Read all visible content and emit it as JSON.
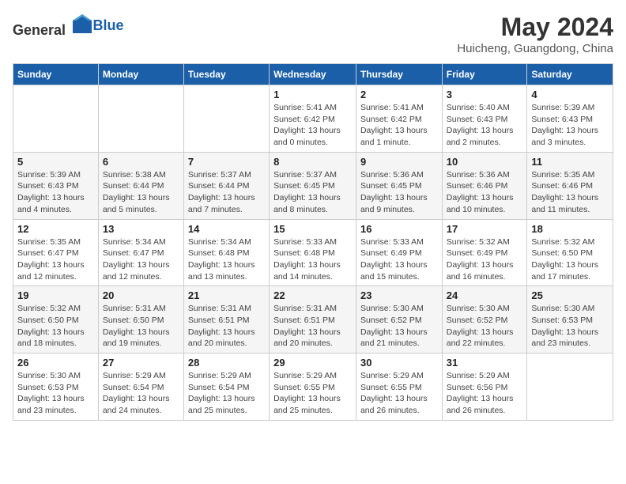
{
  "header": {
    "logo_general": "General",
    "logo_blue": "Blue",
    "month_title": "May 2024",
    "location": "Huicheng, Guangdong, China"
  },
  "weekdays": [
    "Sunday",
    "Monday",
    "Tuesday",
    "Wednesday",
    "Thursday",
    "Friday",
    "Saturday"
  ],
  "weeks": [
    [
      {
        "day": "",
        "sunrise": "",
        "sunset": "",
        "daylight": ""
      },
      {
        "day": "",
        "sunrise": "",
        "sunset": "",
        "daylight": ""
      },
      {
        "day": "",
        "sunrise": "",
        "sunset": "",
        "daylight": ""
      },
      {
        "day": "1",
        "sunrise": "Sunrise: 5:41 AM",
        "sunset": "Sunset: 6:42 PM",
        "daylight": "Daylight: 13 hours and 0 minutes."
      },
      {
        "day": "2",
        "sunrise": "Sunrise: 5:41 AM",
        "sunset": "Sunset: 6:42 PM",
        "daylight": "Daylight: 13 hours and 1 minute."
      },
      {
        "day": "3",
        "sunrise": "Sunrise: 5:40 AM",
        "sunset": "Sunset: 6:43 PM",
        "daylight": "Daylight: 13 hours and 2 minutes."
      },
      {
        "day": "4",
        "sunrise": "Sunrise: 5:39 AM",
        "sunset": "Sunset: 6:43 PM",
        "daylight": "Daylight: 13 hours and 3 minutes."
      }
    ],
    [
      {
        "day": "5",
        "sunrise": "Sunrise: 5:39 AM",
        "sunset": "Sunset: 6:43 PM",
        "daylight": "Daylight: 13 hours and 4 minutes."
      },
      {
        "day": "6",
        "sunrise": "Sunrise: 5:38 AM",
        "sunset": "Sunset: 6:44 PM",
        "daylight": "Daylight: 13 hours and 5 minutes."
      },
      {
        "day": "7",
        "sunrise": "Sunrise: 5:37 AM",
        "sunset": "Sunset: 6:44 PM",
        "daylight": "Daylight: 13 hours and 7 minutes."
      },
      {
        "day": "8",
        "sunrise": "Sunrise: 5:37 AM",
        "sunset": "Sunset: 6:45 PM",
        "daylight": "Daylight: 13 hours and 8 minutes."
      },
      {
        "day": "9",
        "sunrise": "Sunrise: 5:36 AM",
        "sunset": "Sunset: 6:45 PM",
        "daylight": "Daylight: 13 hours and 9 minutes."
      },
      {
        "day": "10",
        "sunrise": "Sunrise: 5:36 AM",
        "sunset": "Sunset: 6:46 PM",
        "daylight": "Daylight: 13 hours and 10 minutes."
      },
      {
        "day": "11",
        "sunrise": "Sunrise: 5:35 AM",
        "sunset": "Sunset: 6:46 PM",
        "daylight": "Daylight: 13 hours and 11 minutes."
      }
    ],
    [
      {
        "day": "12",
        "sunrise": "Sunrise: 5:35 AM",
        "sunset": "Sunset: 6:47 PM",
        "daylight": "Daylight: 13 hours and 12 minutes."
      },
      {
        "day": "13",
        "sunrise": "Sunrise: 5:34 AM",
        "sunset": "Sunset: 6:47 PM",
        "daylight": "Daylight: 13 hours and 12 minutes."
      },
      {
        "day": "14",
        "sunrise": "Sunrise: 5:34 AM",
        "sunset": "Sunset: 6:48 PM",
        "daylight": "Daylight: 13 hours and 13 minutes."
      },
      {
        "day": "15",
        "sunrise": "Sunrise: 5:33 AM",
        "sunset": "Sunset: 6:48 PM",
        "daylight": "Daylight: 13 hours and 14 minutes."
      },
      {
        "day": "16",
        "sunrise": "Sunrise: 5:33 AM",
        "sunset": "Sunset: 6:49 PM",
        "daylight": "Daylight: 13 hours and 15 minutes."
      },
      {
        "day": "17",
        "sunrise": "Sunrise: 5:32 AM",
        "sunset": "Sunset: 6:49 PM",
        "daylight": "Daylight: 13 hours and 16 minutes."
      },
      {
        "day": "18",
        "sunrise": "Sunrise: 5:32 AM",
        "sunset": "Sunset: 6:50 PM",
        "daylight": "Daylight: 13 hours and 17 minutes."
      }
    ],
    [
      {
        "day": "19",
        "sunrise": "Sunrise: 5:32 AM",
        "sunset": "Sunset: 6:50 PM",
        "daylight": "Daylight: 13 hours and 18 minutes."
      },
      {
        "day": "20",
        "sunrise": "Sunrise: 5:31 AM",
        "sunset": "Sunset: 6:50 PM",
        "daylight": "Daylight: 13 hours and 19 minutes."
      },
      {
        "day": "21",
        "sunrise": "Sunrise: 5:31 AM",
        "sunset": "Sunset: 6:51 PM",
        "daylight": "Daylight: 13 hours and 20 minutes."
      },
      {
        "day": "22",
        "sunrise": "Sunrise: 5:31 AM",
        "sunset": "Sunset: 6:51 PM",
        "daylight": "Daylight: 13 hours and 20 minutes."
      },
      {
        "day": "23",
        "sunrise": "Sunrise: 5:30 AM",
        "sunset": "Sunset: 6:52 PM",
        "daylight": "Daylight: 13 hours and 21 minutes."
      },
      {
        "day": "24",
        "sunrise": "Sunrise: 5:30 AM",
        "sunset": "Sunset: 6:52 PM",
        "daylight": "Daylight: 13 hours and 22 minutes."
      },
      {
        "day": "25",
        "sunrise": "Sunrise: 5:30 AM",
        "sunset": "Sunset: 6:53 PM",
        "daylight": "Daylight: 13 hours and 23 minutes."
      }
    ],
    [
      {
        "day": "26",
        "sunrise": "Sunrise: 5:30 AM",
        "sunset": "Sunset: 6:53 PM",
        "daylight": "Daylight: 13 hours and 23 minutes."
      },
      {
        "day": "27",
        "sunrise": "Sunrise: 5:29 AM",
        "sunset": "Sunset: 6:54 PM",
        "daylight": "Daylight: 13 hours and 24 minutes."
      },
      {
        "day": "28",
        "sunrise": "Sunrise: 5:29 AM",
        "sunset": "Sunset: 6:54 PM",
        "daylight": "Daylight: 13 hours and 25 minutes."
      },
      {
        "day": "29",
        "sunrise": "Sunrise: 5:29 AM",
        "sunset": "Sunset: 6:55 PM",
        "daylight": "Daylight: 13 hours and 25 minutes."
      },
      {
        "day": "30",
        "sunrise": "Sunrise: 5:29 AM",
        "sunset": "Sunset: 6:55 PM",
        "daylight": "Daylight: 13 hours and 26 minutes."
      },
      {
        "day": "31",
        "sunrise": "Sunrise: 5:29 AM",
        "sunset": "Sunset: 6:56 PM",
        "daylight": "Daylight: 13 hours and 26 minutes."
      },
      {
        "day": "",
        "sunrise": "",
        "sunset": "",
        "daylight": ""
      }
    ]
  ]
}
